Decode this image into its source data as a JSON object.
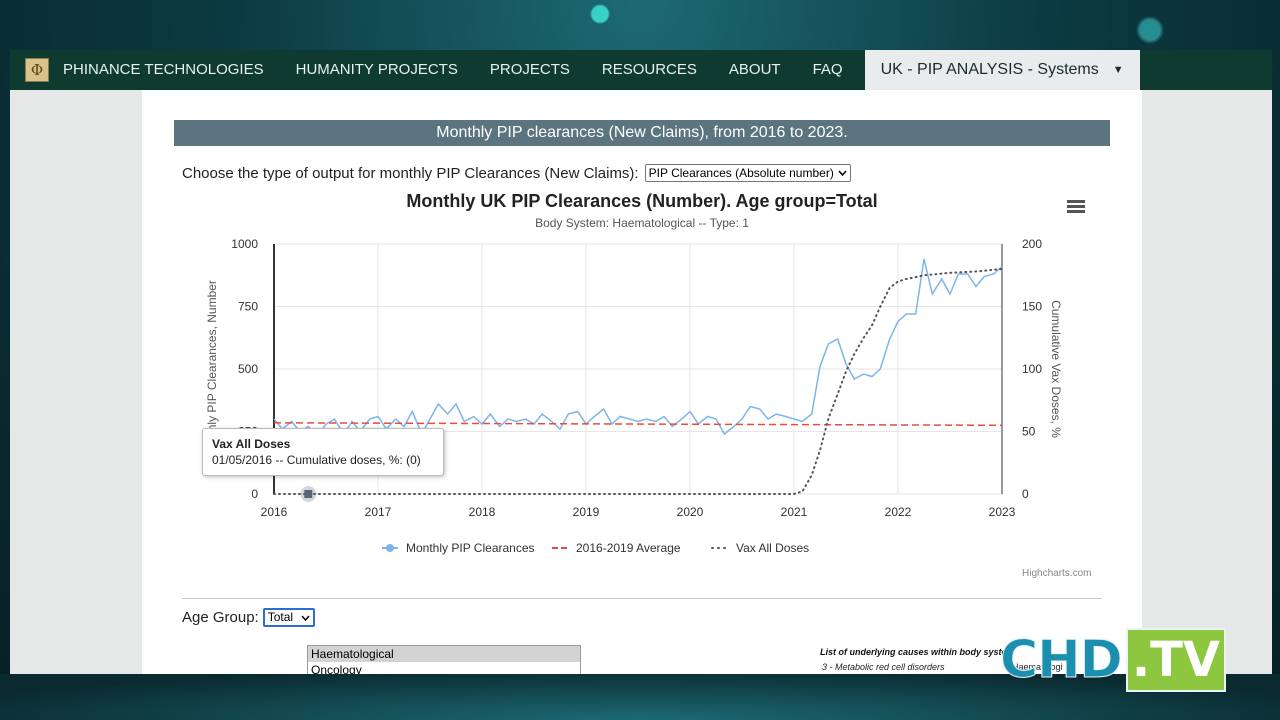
{
  "nav": {
    "brand": "PHINANCE TECHNOLOGIES",
    "logo_symbol": "Φ",
    "items": [
      "HUMANITY PROJECTS",
      "PROJECTS",
      "RESOURCES",
      "ABOUT",
      "FAQ"
    ],
    "active": "UK - PIP ANALYSIS - Systems"
  },
  "header": {
    "title": "Monthly PIP clearances (New Claims), from 2016 to 2023."
  },
  "output_select": {
    "label": "Choose the type of output for monthly PIP Clearances (New Claims):",
    "value": "PIP Clearances (Absolute number)"
  },
  "chart_data": {
    "type": "line",
    "title": "Monthly UK PIP Clearances (Number). Age group=Total",
    "subtitle": "Body System: Haematological -- Type: 1",
    "ylabel": "Monthly PIP Clearances, Number",
    "y2label": "Cumulative Vax Doses, %",
    "x_ticks": [
      "2016",
      "2017",
      "2018",
      "2019",
      "2020",
      "2021",
      "2022",
      "2023"
    ],
    "y_ticks": [
      "0",
      "250",
      "500",
      "750",
      "1000"
    ],
    "y2_ticks": [
      "0",
      "50",
      "100",
      "150",
      "200"
    ],
    "ylim": [
      0,
      1000
    ],
    "y2lim": [
      0,
      200
    ],
    "grid": true,
    "legend_position": "bottom",
    "series": [
      {
        "name": "Monthly PIP Clearances",
        "axis": "left",
        "color": "#7cb5ec",
        "style": "solid",
        "x": [
          2016.0,
          2016.08,
          2016.17,
          2016.25,
          2016.33,
          2016.42,
          2016.5,
          2016.58,
          2016.67,
          2016.75,
          2016.83,
          2016.92,
          2017.0,
          2017.08,
          2017.17,
          2017.25,
          2017.33,
          2017.42,
          2017.5,
          2017.58,
          2017.67,
          2017.75,
          2017.83,
          2017.92,
          2018.0,
          2018.08,
          2018.17,
          2018.25,
          2018.33,
          2018.42,
          2018.5,
          2018.58,
          2018.67,
          2018.75,
          2018.83,
          2018.92,
          2019.0,
          2019.08,
          2019.17,
          2019.25,
          2019.33,
          2019.42,
          2019.5,
          2019.58,
          2019.67,
          2019.75,
          2019.83,
          2019.92,
          2020.0,
          2020.08,
          2020.17,
          2020.25,
          2020.33,
          2020.42,
          2020.5,
          2020.58,
          2020.67,
          2020.75,
          2020.83,
          2020.92,
          2021.0,
          2021.08,
          2021.17,
          2021.25,
          2021.33,
          2021.42,
          2021.5,
          2021.58,
          2021.67,
          2021.75,
          2021.83,
          2021.92,
          2022.0,
          2022.08,
          2022.17,
          2022.25,
          2022.33,
          2022.42,
          2022.5,
          2022.58,
          2022.67,
          2022.75,
          2022.83,
          2022.92,
          2023.0
        ],
        "values": [
          300,
          260,
          290,
          250,
          270,
          230,
          280,
          300,
          240,
          290,
          250,
          300,
          310,
          260,
          300,
          270,
          330,
          240,
          300,
          360,
          320,
          360,
          290,
          310,
          280,
          320,
          270,
          300,
          290,
          300,
          280,
          320,
          290,
          260,
          320,
          330,
          280,
          310,
          340,
          280,
          310,
          300,
          290,
          300,
          290,
          310,
          270,
          300,
          330,
          280,
          310,
          300,
          240,
          270,
          300,
          350,
          340,
          300,
          320,
          310,
          300,
          290,
          320,
          510,
          600,
          620,
          520,
          460,
          480,
          470,
          500,
          620,
          690,
          720,
          720,
          940,
          800,
          860,
          800,
          880,
          880,
          830,
          870,
          880,
          910
        ]
      },
      {
        "name": "2016-2019 Average",
        "axis": "left",
        "color": "#e74c3c",
        "style": "dashed",
        "x": [
          2016,
          2023
        ],
        "values": [
          285,
          275
        ]
      },
      {
        "name": "Vax All Doses",
        "axis": "right",
        "color": "#555555",
        "style": "dotted",
        "x": [
          2016,
          2021.0,
          2021.08,
          2021.17,
          2021.25,
          2021.33,
          2021.42,
          2021.5,
          2021.58,
          2021.67,
          2021.75,
          2021.83,
          2021.92,
          2022.0,
          2022.08,
          2022.25,
          2022.5,
          2022.75,
          2023.0
        ],
        "values": [
          0,
          0,
          2,
          15,
          35,
          60,
          80,
          98,
          112,
          125,
          135,
          150,
          165,
          170,
          172,
          175,
          177,
          178,
          180
        ]
      }
    ]
  },
  "tooltip": {
    "title": "Vax All Doses",
    "body": "01/05/2016 -- Cumulative doses, %: (0)"
  },
  "credit": "Highcharts.com",
  "age_group": {
    "label": "Age Group:",
    "value": "Total"
  },
  "body_systems": {
    "items": [
      "Haematological",
      "Oncology"
    ],
    "selected": "Haematological"
  },
  "causes": {
    "title": "List of underlying causes within body system",
    "first_item": "3 - Metabolic red cell disorders",
    "system": "Haematologi"
  },
  "watermark": {
    "text": "CHD",
    "suffix": ".TV"
  }
}
